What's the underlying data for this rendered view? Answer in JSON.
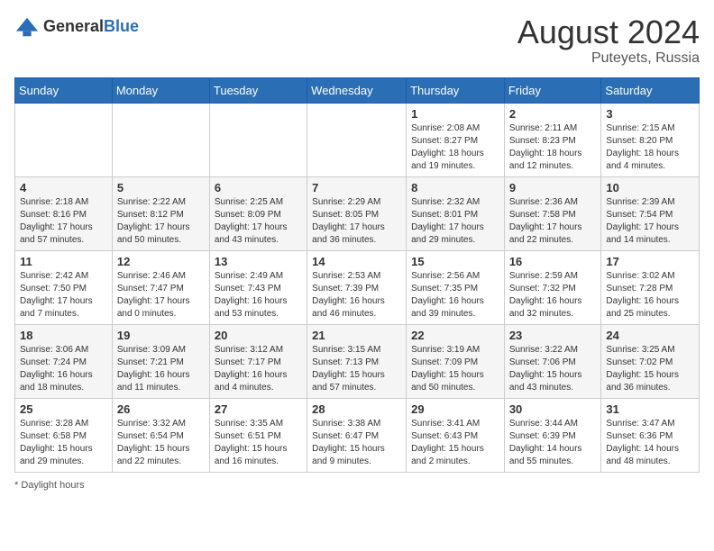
{
  "logo": {
    "text_general": "General",
    "text_blue": "Blue"
  },
  "title": {
    "month_year": "August 2024",
    "location": "Puteyets, Russia"
  },
  "days_of_week": [
    "Sunday",
    "Monday",
    "Tuesday",
    "Wednesday",
    "Thursday",
    "Friday",
    "Saturday"
  ],
  "footer": {
    "note": "Daylight hours"
  },
  "weeks": [
    [
      {
        "day": "",
        "sunrise": "",
        "sunset": "",
        "daylight": ""
      },
      {
        "day": "",
        "sunrise": "",
        "sunset": "",
        "daylight": ""
      },
      {
        "day": "",
        "sunrise": "",
        "sunset": "",
        "daylight": ""
      },
      {
        "day": "",
        "sunrise": "",
        "sunset": "",
        "daylight": ""
      },
      {
        "day": "1",
        "sunrise": "Sunrise: 2:08 AM",
        "sunset": "Sunset: 8:27 PM",
        "daylight": "Daylight: 18 hours and 19 minutes."
      },
      {
        "day": "2",
        "sunrise": "Sunrise: 2:11 AM",
        "sunset": "Sunset: 8:23 PM",
        "daylight": "Daylight: 18 hours and 12 minutes."
      },
      {
        "day": "3",
        "sunrise": "Sunrise: 2:15 AM",
        "sunset": "Sunset: 8:20 PM",
        "daylight": "Daylight: 18 hours and 4 minutes."
      }
    ],
    [
      {
        "day": "4",
        "sunrise": "Sunrise: 2:18 AM",
        "sunset": "Sunset: 8:16 PM",
        "daylight": "Daylight: 17 hours and 57 minutes."
      },
      {
        "day": "5",
        "sunrise": "Sunrise: 2:22 AM",
        "sunset": "Sunset: 8:12 PM",
        "daylight": "Daylight: 17 hours and 50 minutes."
      },
      {
        "day": "6",
        "sunrise": "Sunrise: 2:25 AM",
        "sunset": "Sunset: 8:09 PM",
        "daylight": "Daylight: 17 hours and 43 minutes."
      },
      {
        "day": "7",
        "sunrise": "Sunrise: 2:29 AM",
        "sunset": "Sunset: 8:05 PM",
        "daylight": "Daylight: 17 hours and 36 minutes."
      },
      {
        "day": "8",
        "sunrise": "Sunrise: 2:32 AM",
        "sunset": "Sunset: 8:01 PM",
        "daylight": "Daylight: 17 hours and 29 minutes."
      },
      {
        "day": "9",
        "sunrise": "Sunrise: 2:36 AM",
        "sunset": "Sunset: 7:58 PM",
        "daylight": "Daylight: 17 hours and 22 minutes."
      },
      {
        "day": "10",
        "sunrise": "Sunrise: 2:39 AM",
        "sunset": "Sunset: 7:54 PM",
        "daylight": "Daylight: 17 hours and 14 minutes."
      }
    ],
    [
      {
        "day": "11",
        "sunrise": "Sunrise: 2:42 AM",
        "sunset": "Sunset: 7:50 PM",
        "daylight": "Daylight: 17 hours and 7 minutes."
      },
      {
        "day": "12",
        "sunrise": "Sunrise: 2:46 AM",
        "sunset": "Sunset: 7:47 PM",
        "daylight": "Daylight: 17 hours and 0 minutes."
      },
      {
        "day": "13",
        "sunrise": "Sunrise: 2:49 AM",
        "sunset": "Sunset: 7:43 PM",
        "daylight": "Daylight: 16 hours and 53 minutes."
      },
      {
        "day": "14",
        "sunrise": "Sunrise: 2:53 AM",
        "sunset": "Sunset: 7:39 PM",
        "daylight": "Daylight: 16 hours and 46 minutes."
      },
      {
        "day": "15",
        "sunrise": "Sunrise: 2:56 AM",
        "sunset": "Sunset: 7:35 PM",
        "daylight": "Daylight: 16 hours and 39 minutes."
      },
      {
        "day": "16",
        "sunrise": "Sunrise: 2:59 AM",
        "sunset": "Sunset: 7:32 PM",
        "daylight": "Daylight: 16 hours and 32 minutes."
      },
      {
        "day": "17",
        "sunrise": "Sunrise: 3:02 AM",
        "sunset": "Sunset: 7:28 PM",
        "daylight": "Daylight: 16 hours and 25 minutes."
      }
    ],
    [
      {
        "day": "18",
        "sunrise": "Sunrise: 3:06 AM",
        "sunset": "Sunset: 7:24 PM",
        "daylight": "Daylight: 16 hours and 18 minutes."
      },
      {
        "day": "19",
        "sunrise": "Sunrise: 3:09 AM",
        "sunset": "Sunset: 7:21 PM",
        "daylight": "Daylight: 16 hours and 11 minutes."
      },
      {
        "day": "20",
        "sunrise": "Sunrise: 3:12 AM",
        "sunset": "Sunset: 7:17 PM",
        "daylight": "Daylight: 16 hours and 4 minutes."
      },
      {
        "day": "21",
        "sunrise": "Sunrise: 3:15 AM",
        "sunset": "Sunset: 7:13 PM",
        "daylight": "Daylight: 15 hours and 57 minutes."
      },
      {
        "day": "22",
        "sunrise": "Sunrise: 3:19 AM",
        "sunset": "Sunset: 7:09 PM",
        "daylight": "Daylight: 15 hours and 50 minutes."
      },
      {
        "day": "23",
        "sunrise": "Sunrise: 3:22 AM",
        "sunset": "Sunset: 7:06 PM",
        "daylight": "Daylight: 15 hours and 43 minutes."
      },
      {
        "day": "24",
        "sunrise": "Sunrise: 3:25 AM",
        "sunset": "Sunset: 7:02 PM",
        "daylight": "Daylight: 15 hours and 36 minutes."
      }
    ],
    [
      {
        "day": "25",
        "sunrise": "Sunrise: 3:28 AM",
        "sunset": "Sunset: 6:58 PM",
        "daylight": "Daylight: 15 hours and 29 minutes."
      },
      {
        "day": "26",
        "sunrise": "Sunrise: 3:32 AM",
        "sunset": "Sunset: 6:54 PM",
        "daylight": "Daylight: 15 hours and 22 minutes."
      },
      {
        "day": "27",
        "sunrise": "Sunrise: 3:35 AM",
        "sunset": "Sunset: 6:51 PM",
        "daylight": "Daylight: 15 hours and 16 minutes."
      },
      {
        "day": "28",
        "sunrise": "Sunrise: 3:38 AM",
        "sunset": "Sunset: 6:47 PM",
        "daylight": "Daylight: 15 hours and 9 minutes."
      },
      {
        "day": "29",
        "sunrise": "Sunrise: 3:41 AM",
        "sunset": "Sunset: 6:43 PM",
        "daylight": "Daylight: 15 hours and 2 minutes."
      },
      {
        "day": "30",
        "sunrise": "Sunrise: 3:44 AM",
        "sunset": "Sunset: 6:39 PM",
        "daylight": "Daylight: 14 hours and 55 minutes."
      },
      {
        "day": "31",
        "sunrise": "Sunrise: 3:47 AM",
        "sunset": "Sunset: 6:36 PM",
        "daylight": "Daylight: 14 hours and 48 minutes."
      }
    ]
  ]
}
